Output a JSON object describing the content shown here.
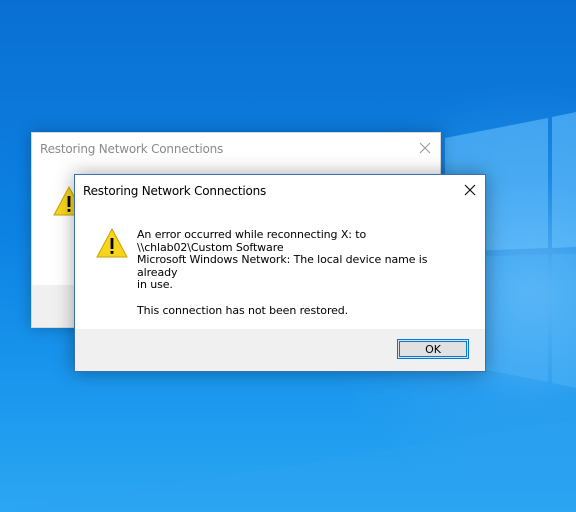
{
  "desktop": {
    "background_color": "#0b78dc"
  },
  "back_dialog": {
    "title": "Restoring Network Connections",
    "icon": "warning-icon",
    "close_icon": "close-icon"
  },
  "front_dialog": {
    "title": "Restoring Network Connections",
    "icon": "warning-icon",
    "close_icon": "close-icon",
    "message_line1": "An error occurred while reconnecting X: to",
    "message_line2": "\\\\chlab02\\Custom Software",
    "message_line3": "Microsoft Windows Network: The local device name is already",
    "message_line4": "in use.",
    "message_line5": "This connection has not been restored.",
    "ok_label": "OK",
    "accent_color": "#0078d7"
  }
}
